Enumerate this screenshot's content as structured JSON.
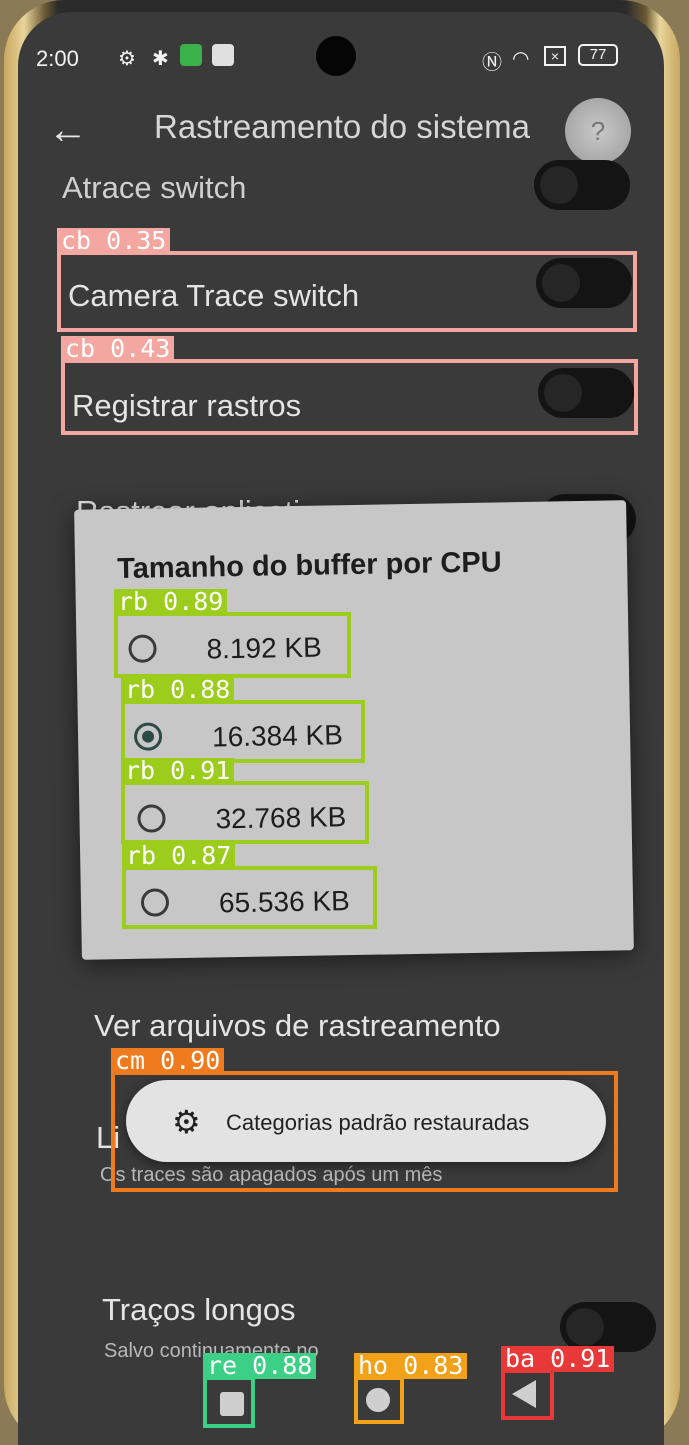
{
  "status_bar": {
    "time": "2:00",
    "battery": "77",
    "icons": [
      "settings-gear-icon",
      "bug-icon",
      "app-icon",
      "app-icon-2",
      "nfc-icon",
      "wifi-icon",
      "sim-off-icon",
      "battery-icon"
    ]
  },
  "app_bar": {
    "back_icon": "←",
    "title": "Rastreamento do sistema",
    "help_icon": "?"
  },
  "settings": {
    "atrace_label": "Atrace switch",
    "camera_trace_label": "Camera Trace switch",
    "registrar_label": "Registrar rastros",
    "rastrear_apps_label": "Rastrear aplicativos",
    "ver_arquivos_label": "Ver arquivos de rastreamento",
    "limite_label": "Li",
    "limite_sub": "Os traces são apagados após um mês",
    "tracos_longos_label": "Traços longos",
    "tracos_longos_sub": "Salvo continuamente no"
  },
  "dialog": {
    "title": "Tamanho do buffer por CPU",
    "options": [
      {
        "label": "8.192 KB",
        "selected": false
      },
      {
        "label": "16.384 KB",
        "selected": true
      },
      {
        "label": "32.768 KB",
        "selected": false
      },
      {
        "label": "65.536 KB",
        "selected": false
      }
    ]
  },
  "toast": {
    "icon": "⚙",
    "text": "Categorias padrão restauradas"
  },
  "detections": [
    {
      "tag": "cb 0.35",
      "color": "#f4a6a0"
    },
    {
      "tag": "cb 0.43",
      "color": "#f4a6a0"
    },
    {
      "tag": "rb 0.89",
      "color": "#9ccc1c"
    },
    {
      "tag": "rb 0.88",
      "color": "#9ccc1c"
    },
    {
      "tag": "rb 0.91",
      "color": "#9ccc1c"
    },
    {
      "tag": "rb 0.87",
      "color": "#9ccc1c"
    },
    {
      "tag": "cm 0.90",
      "color": "#f07a1e"
    },
    {
      "tag": "re 0.88",
      "color": "#3ccf86"
    },
    {
      "tag": "ho 0.83",
      "color": "#f2a218"
    },
    {
      "tag": "ba 0.91",
      "color": "#e83838"
    }
  ]
}
